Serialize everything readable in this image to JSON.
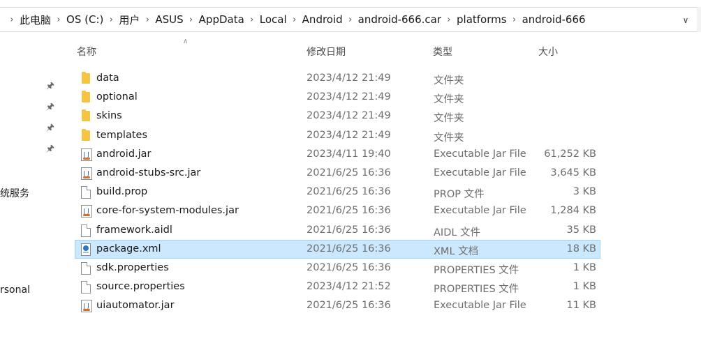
{
  "breadcrumb": [
    "此电脑",
    "OS (C:)",
    "用户",
    "ASUS",
    "AppData",
    "Local",
    "Android",
    "android-666.car",
    "platforms",
    "android-666"
  ],
  "nav": {
    "labels": [
      "统服务",
      "rsonal"
    ]
  },
  "columns": {
    "name": "名称",
    "date": "修改日期",
    "type": "类型",
    "size": "大小"
  },
  "files": [
    {
      "name": "data",
      "date": "2023/4/12 21:49",
      "type": "文件夹",
      "size": "",
      "icon": "folder-icon"
    },
    {
      "name": "optional",
      "date": "2023/4/12 21:49",
      "type": "文件夹",
      "size": "",
      "icon": "folder-icon"
    },
    {
      "name": "skins",
      "date": "2023/4/12 21:49",
      "type": "文件夹",
      "size": "",
      "icon": "folder-icon"
    },
    {
      "name": "templates",
      "date": "2023/4/12 21:49",
      "type": "文件夹",
      "size": "",
      "icon": "folder-icon"
    },
    {
      "name": "android.jar",
      "date": "2023/4/11 19:40",
      "type": "Executable Jar File",
      "size": "61,252 KB",
      "icon": "jar-icon"
    },
    {
      "name": "android-stubs-src.jar",
      "date": "2021/6/25 16:36",
      "type": "Executable Jar File",
      "size": "3,645 KB",
      "icon": "jar-icon"
    },
    {
      "name": "build.prop",
      "date": "2021/6/25 16:36",
      "type": "PROP 文件",
      "size": "3 KB",
      "icon": "file-icon"
    },
    {
      "name": "core-for-system-modules.jar",
      "date": "2021/6/25 16:36",
      "type": "Executable Jar File",
      "size": "1,284 KB",
      "icon": "jar-icon"
    },
    {
      "name": "framework.aidl",
      "date": "2021/6/25 16:36",
      "type": "AIDL 文件",
      "size": "35 KB",
      "icon": "file-icon"
    },
    {
      "name": "package.xml",
      "date": "2021/6/25 16:36",
      "type": "XML 文档",
      "size": "18 KB",
      "icon": "xml-icon",
      "selected": true
    },
    {
      "name": "sdk.properties",
      "date": "2021/6/25 16:36",
      "type": "PROPERTIES 文件",
      "size": "1 KB",
      "icon": "file-icon"
    },
    {
      "name": "source.properties",
      "date": "2023/4/12 21:52",
      "type": "PROPERTIES 文件",
      "size": "1 KB",
      "icon": "file-icon"
    },
    {
      "name": "uiautomator.jar",
      "date": "2021/6/25 16:36",
      "type": "Executable Jar File",
      "size": "11 KB",
      "icon": "jar-icon"
    }
  ]
}
